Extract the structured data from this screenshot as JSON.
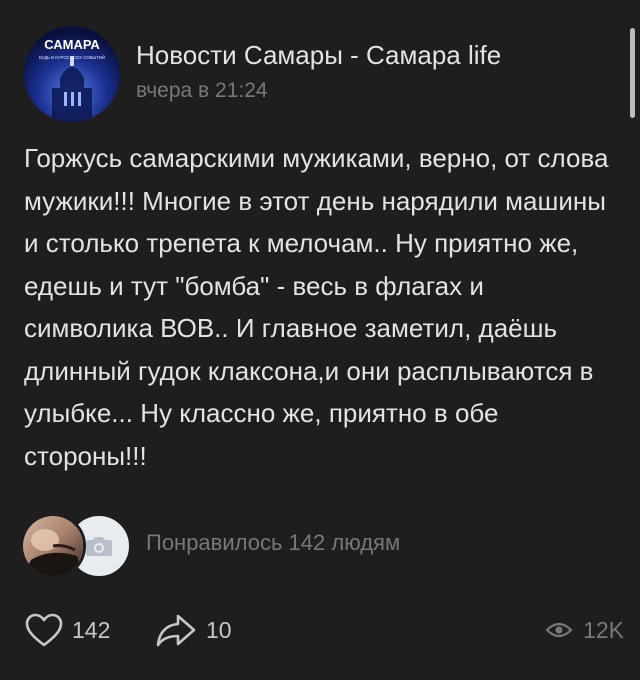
{
  "post": {
    "author": "Новости Самары -  Самара life",
    "timestamp": "вчера в 21:24",
    "avatar": {
      "title": "САМАРА",
      "subtitle": "БУДЬ В КУРСЕ ВСЕХ СОБЫТИЙ"
    },
    "text": "Горжусь самарскими мужиками, верно, от слова мужики!!! Многие в этот день нарядили машины и столько трепета к мелочам.. Ну приятно же, едешь и тут \"бомба\" - весь в флагах и символика ВОВ.. И главное заметил, даёшь длинный гудок клаксона,и они расплываются в улыбке... Ну классно же, приятно в обе стороны!!!",
    "likes_text": "Понравилось 142 людям"
  },
  "actions": {
    "likes": "142",
    "shares": "10",
    "views": "12K"
  },
  "colors": {
    "background": "#1e1e1e",
    "text": "#e1e3e6",
    "secondary": "#76787a"
  },
  "icons": {
    "like": "heart-icon",
    "share": "share-arrow-icon",
    "views": "eye-icon",
    "liker_placeholder": "camera-icon"
  }
}
